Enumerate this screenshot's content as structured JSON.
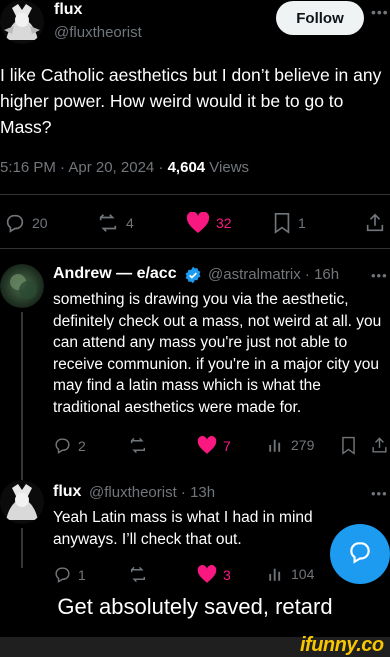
{
  "post": {
    "author_name": "flux",
    "author_handle": "@fluxtheorist",
    "follow_label": "Follow",
    "text": "I like Catholic aesthetics but I don’t believe in any higher power. How weird would it be to go to Mass?",
    "time": "5:16 PM · Apr 20, 2024 · ",
    "views": "4,604",
    "views_label": " Views",
    "stats": {
      "replies": "20",
      "reposts": "4",
      "likes": "32",
      "bookmarks": "1"
    }
  },
  "replies": [
    {
      "name": "Andrew — e/acc",
      "handle": "@astralmatrix · 16h",
      "text": "something is drawing you via the aesthetic, definitely check out a mass, not weird at all. you can attend any mass you're just not able to receive communion. if you're in a major city you may find a latin mass which is what the traditional  aesthetics were made for.",
      "stats": {
        "replies": "2",
        "reposts": "",
        "likes": "7",
        "views": "279"
      }
    },
    {
      "name": "flux",
      "handle": "@fluxtheorist · 13h",
      "text": "Yeah Latin mass is what I had in mind anyways. I’ll check that out.",
      "stats": {
        "replies": "1",
        "reposts": "",
        "likes": "3",
        "views": "104"
      }
    }
  ],
  "caption": "Get absolutely saved, retard",
  "watermark": "ifunny.co",
  "colors": {
    "accent": "#1d9bf0",
    "like": "#f91880",
    "muted": "#71767b",
    "verified": "#1d9bf0"
  }
}
